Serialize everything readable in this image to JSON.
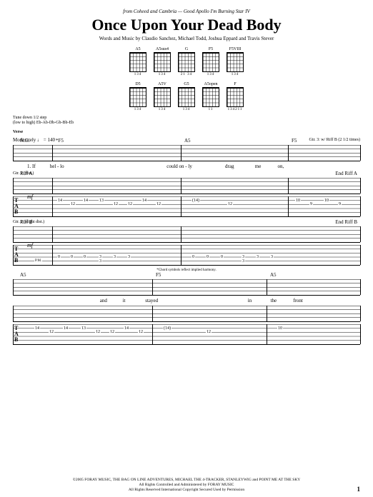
{
  "header": {
    "source": "from Coheed and Cambria — Good Apollo I'm Burning Star IV",
    "title": "Once Upon Your Dead Body",
    "credits": "Words and Music by Claudio Sanchez, Michael Todd, Joshua Eppard and Travis Stever"
  },
  "chords": [
    {
      "name": "A5",
      "fingering": "134"
    },
    {
      "name": "A5sus4",
      "fingering": "134"
    },
    {
      "name": "G",
      "fingering": "21 34"
    },
    {
      "name": "F5",
      "fingering": "134"
    },
    {
      "name": "F5VIII",
      "fingering": "134"
    },
    {
      "name": "D5",
      "fingering": "134"
    },
    {
      "name": "A5V",
      "fingering": "134"
    },
    {
      "name": "G5",
      "fingering": "134"
    },
    {
      "name": "A5open",
      "fingering": "11"
    },
    {
      "name": "F",
      "fingering": "134211"
    }
  ],
  "meta": {
    "tuning": "Tune down 1/2 step",
    "tuning_detail": "(low to high) Eb-Ab-Db-Gb-Bb-Eb",
    "section": "Verse",
    "tempo": "Moderately ♩ = 140",
    "chord_note": "*Chord symbols reflect implied harmony.",
    "slash_note": "Gtr. 3: w/ Riff B (2 1/2 times)"
  },
  "chord_line1": [
    "N.C.",
    "*F5",
    "A5",
    "F5"
  ],
  "chord_line2": [
    "A5",
    "F5",
    "A5"
  ],
  "lyrics": {
    "line1": [
      "1. If",
      "hel - lo",
      "",
      "could on - ly",
      "drag",
      "me",
      "on,"
    ],
    "line2": [
      "",
      "and",
      "it",
      "stayed",
      "",
      "in",
      "the",
      "front"
    ]
  },
  "gtr_labels": {
    "g1": "Gtr. 1 (dist.)",
    "g1_riff": "Riff A",
    "g1_end": "End Riff A",
    "g2": "Gtr. 2 (slight dist.)",
    "g2_riff": "Riff B",
    "g2_end": "End Riff B"
  },
  "dynamics": {
    "mf": "mf"
  },
  "tab1": [
    "14",
    "12",
    "14",
    "13",
    "12",
    "12",
    "14",
    "12",
    "(14)",
    "12",
    "10",
    "9",
    "10",
    "9"
  ],
  "tab2": [
    "0",
    "0",
    "0",
    "3",
    "3",
    "3",
    "0",
    "0",
    "0",
    "3",
    "3",
    "3"
  ],
  "tab2_low": [
    "3",
    "3",
    "3",
    "3"
  ],
  "tab3": [
    "14",
    "12",
    "14",
    "13",
    "12",
    "12",
    "14",
    "12",
    "(14)",
    "12",
    "10"
  ],
  "pm": "P.M.",
  "footer": {
    "c1": "©2005 FORAY MUSIC, THE BAG ON LINE ADVENTURES, MICHAEL THE 4-TRACKER, STANLEYWIG and POINT ME AT THE SKY",
    "c2": "All Rights Controlled and Administered by FORAY MUSIC",
    "c3": "All Rights Reserved   International Copyright Secured   Used by Permission"
  },
  "page": "1"
}
